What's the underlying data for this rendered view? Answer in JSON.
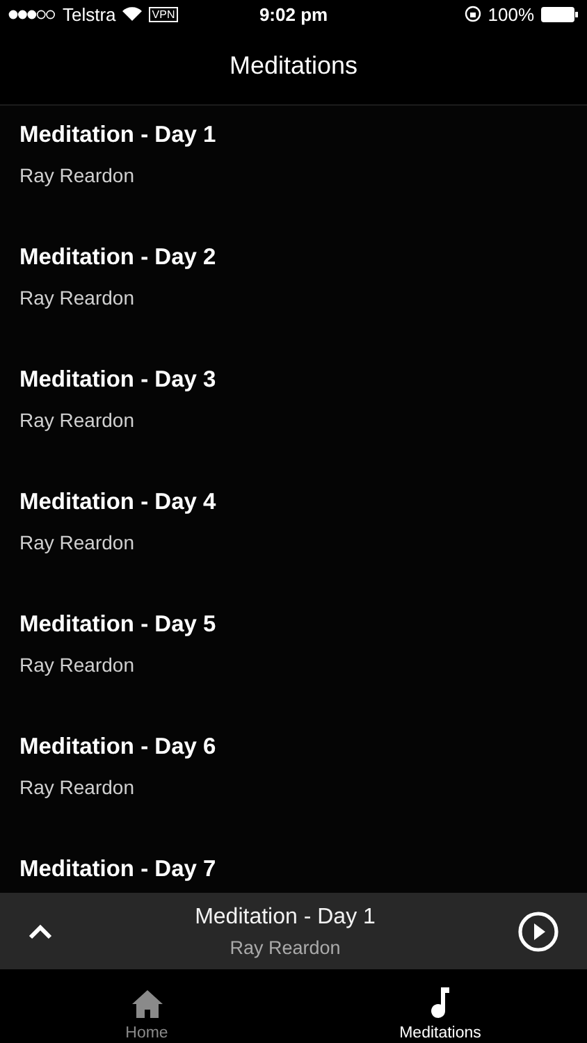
{
  "status_bar": {
    "carrier": "Telstra",
    "vpn": "VPN",
    "time": "9:02 pm",
    "battery": "100%"
  },
  "nav_bar": {
    "title": "Meditations"
  },
  "meditations": [
    {
      "title": "Meditation - Day 1",
      "author": "Ray Reardon"
    },
    {
      "title": "Meditation - Day 2",
      "author": "Ray Reardon"
    },
    {
      "title": "Meditation - Day 3",
      "author": "Ray Reardon"
    },
    {
      "title": "Meditation - Day 4",
      "author": "Ray Reardon"
    },
    {
      "title": "Meditation - Day 5",
      "author": "Ray Reardon"
    },
    {
      "title": "Meditation - Day 6",
      "author": "Ray Reardon"
    },
    {
      "title": "Meditation - Day 7"
    }
  ],
  "player": {
    "title": "Meditation - Day 1",
    "author": "Ray Reardon"
  },
  "tabs": [
    {
      "label": "Home",
      "selected": false
    },
    {
      "label": "Meditations",
      "selected": true
    }
  ]
}
